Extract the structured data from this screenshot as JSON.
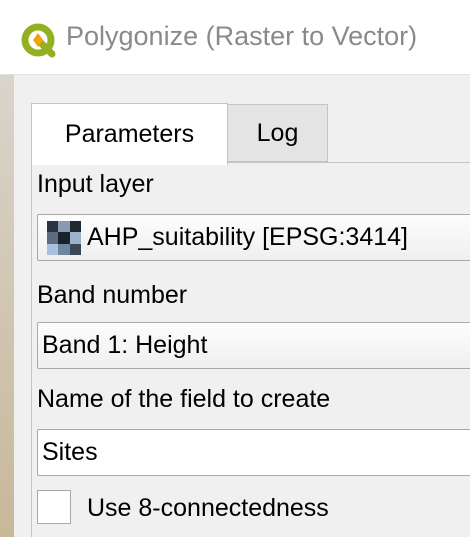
{
  "window": {
    "title": "Polygonize (Raster to Vector)",
    "icon": "qgis-logo-icon"
  },
  "tabs": [
    {
      "label": "Parameters",
      "active": true
    },
    {
      "label": "Log",
      "active": false
    }
  ],
  "params": {
    "input_layer": {
      "label": "Input layer",
      "value": "AHP_suitability [EPSG:3414]",
      "icon": "raster-layer-icon"
    },
    "band_number": {
      "label": "Band number",
      "value": "Band 1: Height"
    },
    "field_name": {
      "label": "Name of the field to create",
      "value": "Sites"
    },
    "connectedness": {
      "label": "Use 8-connectedness",
      "checked": false
    }
  },
  "colors": {
    "qgis_green": "#589632",
    "qgis_yellow": "#ee7913",
    "title_text": "#8a8a8a"
  }
}
